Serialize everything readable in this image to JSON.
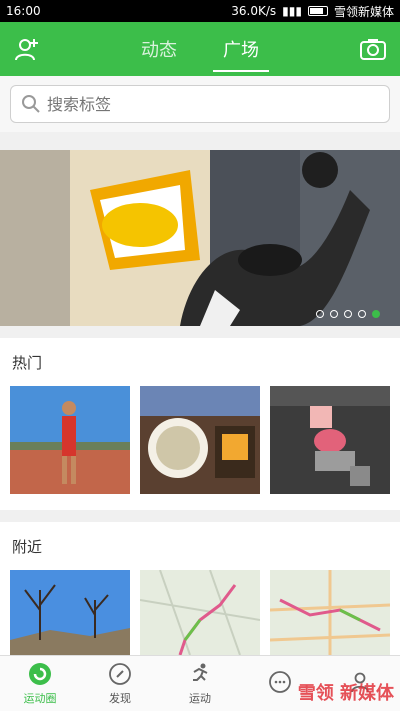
{
  "status": {
    "time": "16:00",
    "network": "36.0K/s",
    "carrier": "雪领新媒体"
  },
  "header": {
    "tabs": [
      {
        "label": "动态",
        "active": false
      },
      {
        "label": "广场",
        "active": true
      }
    ],
    "left_icon": "add-friend-icon",
    "right_icon": "camera-icon"
  },
  "search": {
    "placeholder": "搜索标签",
    "value": ""
  },
  "banner": {
    "dots": 5,
    "active_dot": 5
  },
  "sections": {
    "hot": {
      "title": "热门"
    },
    "nearby": {
      "title": "附近"
    }
  },
  "tabbar": {
    "items": [
      {
        "label": "运动圈",
        "icon": "moments-icon",
        "active": true
      },
      {
        "label": "发现",
        "icon": "compass-icon",
        "active": false
      },
      {
        "label": "运动",
        "icon": "runner-icon",
        "active": false
      },
      {
        "label": "",
        "icon": "chat-icon",
        "active": false
      },
      {
        "label": "",
        "icon": "profile-icon",
        "active": false
      }
    ]
  },
  "watermark": "雪领 新媒体",
  "colors": {
    "accent": "#3cbe4a",
    "topbar": "#3cbe4a"
  }
}
